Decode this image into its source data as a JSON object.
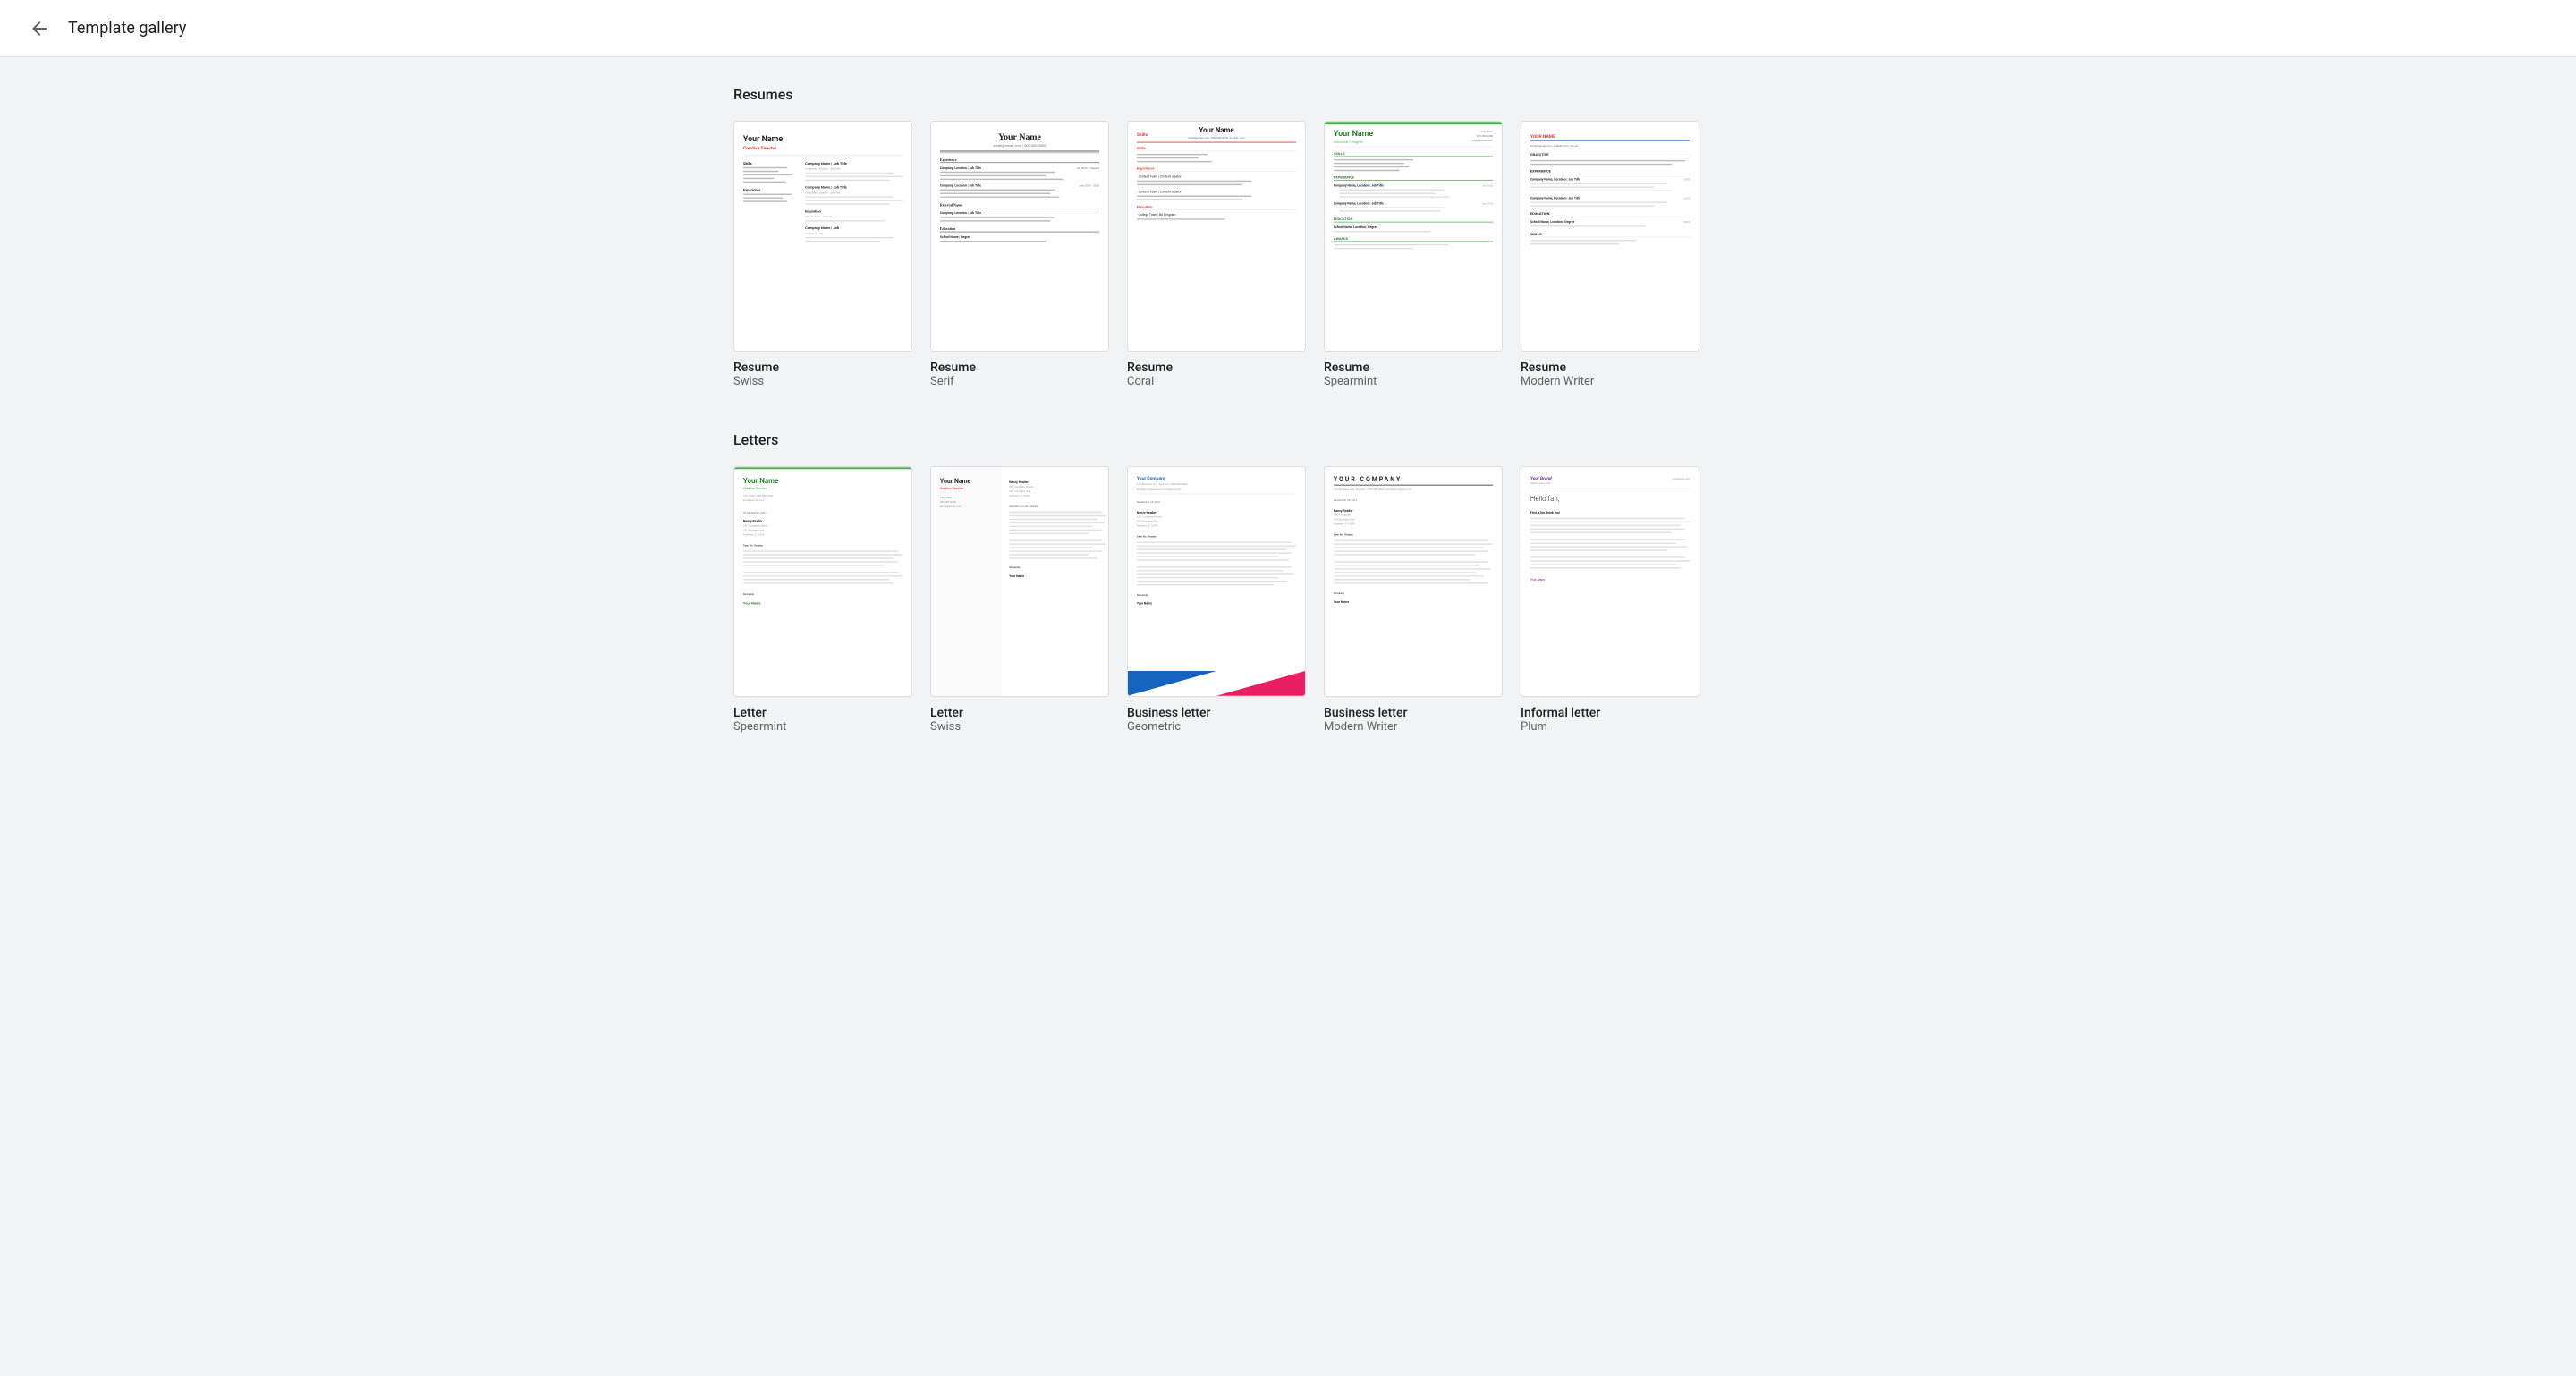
{
  "header": {
    "back_label": "←",
    "title": "Template gallery"
  },
  "sections": [
    {
      "id": "resumes",
      "title": "Resumes",
      "templates": [
        {
          "id": "resume-swiss",
          "type": "Resume",
          "name": "Swiss",
          "style": "swiss"
        },
        {
          "id": "resume-serif",
          "type": "Resume",
          "name": "Serif",
          "style": "serif"
        },
        {
          "id": "resume-coral",
          "type": "Resume",
          "name": "Coral",
          "style": "coral"
        },
        {
          "id": "resume-spearmint",
          "type": "Resume",
          "name": "Spearmint",
          "style": "spearmint"
        },
        {
          "id": "resume-modern-writer",
          "type": "Resume",
          "name": "Modern Writer",
          "style": "modern-writer"
        }
      ]
    },
    {
      "id": "letters",
      "title": "Letters",
      "templates": [
        {
          "id": "letter-spearmint",
          "type": "Letter",
          "name": "Spearmint",
          "style": "letter-spearmint"
        },
        {
          "id": "letter-swiss",
          "type": "Letter",
          "name": "Swiss",
          "style": "letter-swiss"
        },
        {
          "id": "business-letter-geometric",
          "type": "Business letter",
          "name": "Geometric",
          "style": "business-geometric"
        },
        {
          "id": "business-letter-modern-writer",
          "type": "Business letter",
          "name": "Modern Writer",
          "style": "business-modern"
        },
        {
          "id": "informal-letter-plum",
          "type": "Informal letter",
          "name": "Plum",
          "style": "informal-plum"
        }
      ]
    }
  ]
}
